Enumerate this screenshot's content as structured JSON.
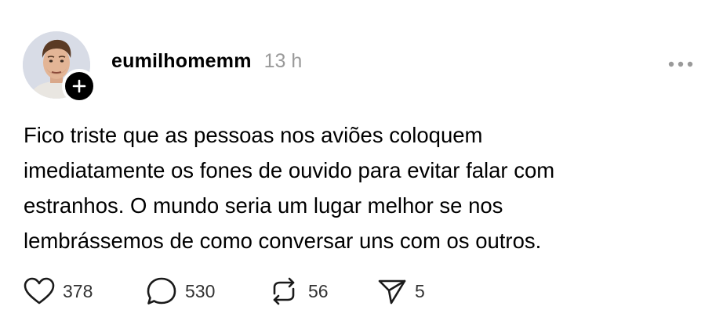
{
  "post": {
    "username": "eumilhomemm",
    "timestamp": "13 h",
    "text_lines": [
      "Fico triste que as pessoas nos aviões coloquem",
      "imediatamente os fones de ouvido para evitar falar com",
      "estranhos. O mundo seria um lugar melhor se nos",
      "lembrássemos de como conversar uns com os outros."
    ],
    "actions": {
      "likes": "378",
      "comments": "530",
      "reposts": "56",
      "shares": "5"
    }
  },
  "icons": {
    "avatar": "profile-photo",
    "follow": "plus-icon",
    "more": "more-horizontal-icon",
    "like": "heart-icon",
    "comment": "speech-bubble-icon",
    "repost": "repost-icon",
    "share": "paper-plane-icon"
  },
  "colors": {
    "text": "#000000",
    "muted": "#9a9a9a",
    "icon": "#1a1a1a",
    "count": "#333333"
  }
}
